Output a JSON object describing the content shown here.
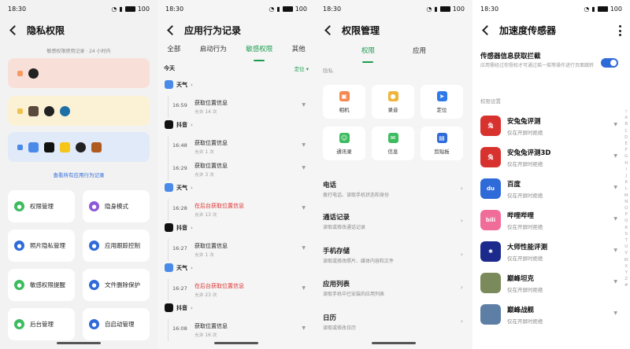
{
  "status": {
    "time": "18:30",
    "battery": "100"
  },
  "p1": {
    "title": "隐私权限",
    "subtitle": "敏感权限使用记录 · 24 小时内",
    "cards": [
      {
        "color": "#f8e0d8",
        "dot": "#f59a63",
        "icon_name": "camera-icon"
      },
      {
        "color": "#fbf2d6",
        "dot": "#f0c24c",
        "icon_name": "microphone-icon"
      },
      {
        "color": "#e1eaf8",
        "dot": "#4a8ae8",
        "icon_name": "location-icon"
      }
    ],
    "link": "查看所有应用行为记录",
    "tiles": [
      {
        "label": "权限管理",
        "color": "#3dbb5e"
      },
      {
        "label": "隐身模式",
        "color": "#8c5ad8"
      },
      {
        "label": "照片隐私管理",
        "color": "#2f6ad9"
      },
      {
        "label": "应用跟踪控制",
        "color": "#2f6ad9"
      },
      {
        "label": "敏感权限提醒",
        "color": "#3dbb5e"
      },
      {
        "label": "文件删除保护",
        "color": "#2f6ad9"
      },
      {
        "label": "后台管理",
        "color": "#3dbb5e"
      },
      {
        "label": "自启动管理",
        "color": "#2f6ad9"
      }
    ]
  },
  "p2": {
    "title": "应用行为记录",
    "tabs": [
      "全部",
      "启动行为",
      "敏感权限",
      "其他"
    ],
    "today": "今天",
    "filter": "定位",
    "entries": [
      {
        "type": "app",
        "app": "天气"
      },
      {
        "type": "event",
        "time": "16:59",
        "event": "获取位置信息",
        "count": "允许 14 次",
        "red": false
      },
      {
        "type": "app",
        "app": "抖音"
      },
      {
        "type": "event",
        "time": "16:48",
        "event": "获取位置信息",
        "count": "允许 1 次",
        "red": false
      },
      {
        "type": "event",
        "time": "16:29",
        "event": "获取位置信息",
        "count": "允许 3 次",
        "red": false
      },
      {
        "type": "app",
        "app": "天气"
      },
      {
        "type": "event",
        "time": "16:28",
        "event": "在后台获取位置信息",
        "count": "允许 13 次",
        "red": true
      },
      {
        "type": "app",
        "app": "抖音"
      },
      {
        "type": "event",
        "time": "16:27",
        "event": "获取位置信息",
        "count": "允许 1 次",
        "red": false
      },
      {
        "type": "app",
        "app": "天气"
      },
      {
        "type": "event",
        "time": "16:27",
        "event": "在后台获取位置信息",
        "count": "允许 23 次",
        "red": true
      },
      {
        "type": "app",
        "app": "抖音"
      },
      {
        "type": "event",
        "time": "16:08",
        "event": "获取位置信息",
        "count": "允许 16 次",
        "red": false
      }
    ]
  },
  "p3": {
    "title": "权限管理",
    "tabs": [
      "权限",
      "应用"
    ],
    "section": "隐私",
    "perms": [
      {
        "label": "相机",
        "color": "#f5874f",
        "icon": "camera-icon"
      },
      {
        "label": "录音",
        "color": "#f0b43a",
        "icon": "microphone-icon"
      },
      {
        "label": "定位",
        "color": "#2f7ae8",
        "icon": "location-icon"
      },
      {
        "label": "通讯录",
        "color": "#3dbb5e",
        "icon": "contacts-icon"
      },
      {
        "label": "信息",
        "color": "#3dbb5e",
        "icon": "message-icon"
      },
      {
        "label": "剪贴板",
        "color": "#2f6ad9",
        "icon": "clipboard-icon"
      }
    ],
    "rows": [
      {
        "title": "电话",
        "desc": "拨打电话、读取手机状态和身份"
      },
      {
        "title": "通话记录",
        "desc": "读取或修改通话记录"
      },
      {
        "title": "手机存储",
        "desc": "读取或修改照片、媒体内容和文件"
      },
      {
        "title": "应用列表",
        "desc": "读取手机中已安装的应用列表"
      },
      {
        "title": "日历",
        "desc": "读取或修改日历"
      }
    ]
  },
  "p4": {
    "title": "加速度传感器",
    "switch_title": "传感器信息获取拦截",
    "switch_desc": "应用需经过你授权才可通过摇一摇等操作进行页面跳转",
    "section": "权限设置",
    "apps": [
      {
        "name": "安兔兔评测",
        "status": "仅在开屏时拒绝",
        "color": "#d8322e",
        "glyph": "兔"
      },
      {
        "name": "安兔兔评测3D",
        "status": "仅在开屏时拒绝",
        "color": "#d8322e",
        "glyph": "兔"
      },
      {
        "name": "百度",
        "status": "仅在开屏时拒绝",
        "color": "#2f6ad9",
        "glyph": "du"
      },
      {
        "name": "哔哩哔哩",
        "status": "仅在开屏时拒绝",
        "color": "#f06d9a",
        "glyph": "bili"
      },
      {
        "name": "大师性能评测",
        "status": "仅在开屏时拒绝",
        "color": "#1b2a8c",
        "glyph": "✱"
      },
      {
        "name": "巅峰坦克",
        "status": "仅在开屏时拒绝",
        "color": "#7a8a5a",
        "glyph": ""
      },
      {
        "name": "巅峰战舰",
        "status": "仅在开屏时拒绝",
        "color": "#5d7fa6",
        "glyph": ""
      }
    ],
    "alphabet": [
      "☆",
      "A",
      "B",
      "C",
      "D",
      "E",
      "F",
      "G",
      "H",
      "I",
      "J",
      "K",
      "L",
      "M",
      "N",
      "O",
      "P",
      "Q",
      "R",
      "S",
      "T",
      "U",
      "V",
      "W",
      "X",
      "Y",
      "Z",
      "#"
    ]
  }
}
